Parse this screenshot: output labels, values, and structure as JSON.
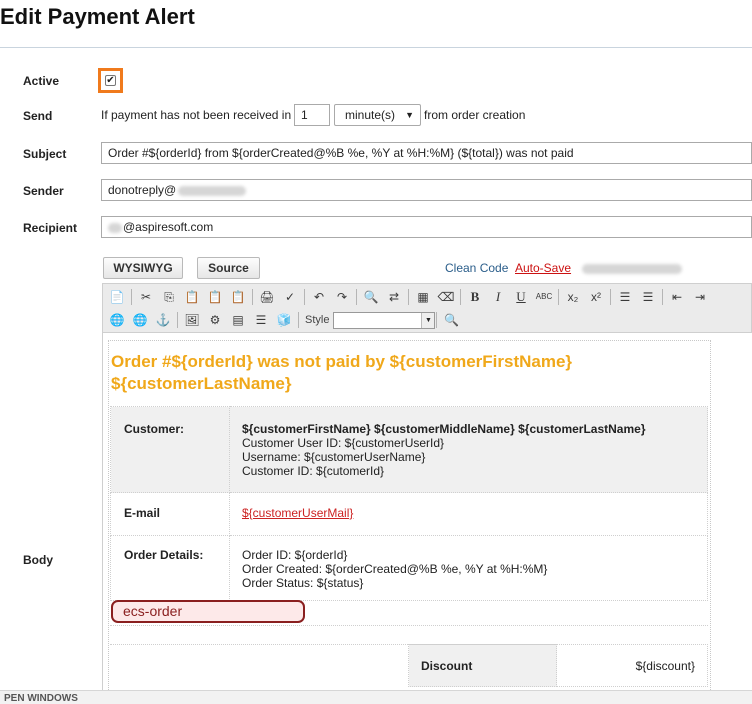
{
  "page": {
    "title": "Edit Payment Alert"
  },
  "labels": {
    "active": "Active",
    "send": "Send",
    "subject": "Subject",
    "sender": "Sender",
    "recipient": "Recipient",
    "body": "Body"
  },
  "active": {
    "checked": true,
    "check_glyph": "✔"
  },
  "send": {
    "prefix": "If payment has not been received in",
    "amount": "1",
    "unit": "minute(s)",
    "suffix": "from order creation"
  },
  "subject": {
    "value": "Order #${orderId} from ${orderCreated@%B %e, %Y at %H:%M} (${total}) was not paid"
  },
  "sender": {
    "value": "donotreply@"
  },
  "recipient": {
    "value": "@aspiresoft.com"
  },
  "editor": {
    "tabs": {
      "wysiwyg": "WYSIWYG",
      "source": "Source"
    },
    "clean_code": "Clean Code",
    "auto_save": "Auto-Save",
    "style_label": "Style",
    "toolbar_row1": [
      "📄",
      "✂",
      "⎘",
      "📋",
      "📋",
      "📋",
      "🖨",
      "✓",
      "↶",
      "↷",
      "🔍",
      "⇄",
      "▦",
      "⌫",
      "B",
      "I",
      "U",
      "ABC",
      "x₂",
      "x²",
      "☰",
      "☰",
      "⇤",
      "⇥"
    ],
    "toolbar_row2": [
      "🌐",
      "🌐",
      "⚓",
      "🖼",
      "⚙",
      "▤",
      "☰",
      "🧊",
      "🔍"
    ]
  },
  "body": {
    "title": "Order #${orderId} was not paid by ${customerFirstName} ${customerLastName}",
    "customer_label": "Customer:",
    "customer_name": "${customerFirstName} ${customerMiddleName} ${customerLastName}",
    "customer_user_id": "Customer User ID: ${customerUserId}",
    "username": "Username: ${customerUserName}",
    "customer_id": "Customer ID: ${cutomerId}",
    "email_label": "E-mail",
    "email_value": "${customerUserMail}",
    "order_details_label": "Order Details:",
    "order_id": "Order ID: ${orderId}",
    "order_created": "Order Created: ${orderCreated@%B %e, %Y at %H:%M}",
    "order_status": "Order Status: ${status}",
    "ecs_tag": "ecs-order",
    "discount_label": "Discount",
    "discount_value": "${discount}"
  },
  "footer": {
    "text": "PEN WINDOWS"
  }
}
